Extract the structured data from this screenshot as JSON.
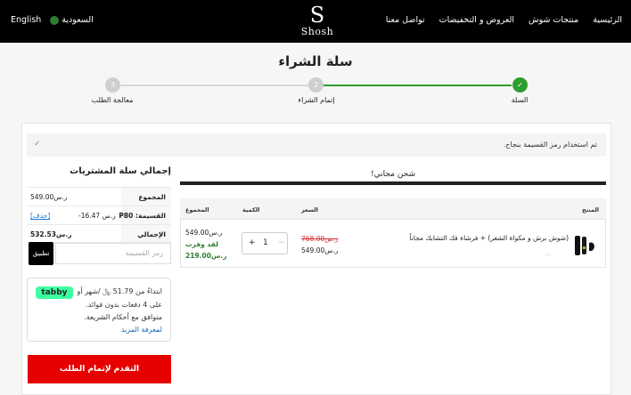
{
  "header": {
    "logo_glyph": "S",
    "logo_text": "Shosh",
    "nav": [
      "الرئيسية",
      "منتجات شوش",
      "العروض و التخفيضات",
      "تواصل معنا"
    ],
    "country": "السعودية",
    "language": "English"
  },
  "page_title": "سلة الشراء",
  "steps": [
    {
      "label": "السلة",
      "number": "✓",
      "state": "done"
    },
    {
      "label": "إتمام الشراء",
      "number": "2",
      "state": "pending"
    },
    {
      "label": "معالجة الطلب",
      "number": "3",
      "state": "pending"
    }
  ],
  "notice": {
    "text": "تم استخدام رمز القسيمة بنجاح.",
    "icon": "check-icon"
  },
  "summary": {
    "title": "إجمالي سلة المشتريات",
    "subtotal_label": "المجموع",
    "subtotal_value": "549.00ر.س",
    "coupon_label": "القسيمة: P80",
    "coupon_value": "-ر.س 16.47",
    "coupon_remove": "[حذف]",
    "total_label": "الإجمالي",
    "total_value": "532.53ر.س",
    "coupon_placeholder": "رمز القسيمة",
    "apply_label": "تطبيق"
  },
  "tabby": {
    "logo": "tabby",
    "line1": "ابتداءً من 51.79 ﷼ /شهر أو",
    "line2": "على 4 دفعات بدون فوائد.",
    "line3": "متوافق مع أحكام الشريعة.",
    "more": "لمعرفة المزيد"
  },
  "checkout_label": "التقدم لإتمام الطلب",
  "shipping": {
    "label": "شحن مجاني!",
    "progress": 1.0
  },
  "table": {
    "headers": {
      "product": "المنتج",
      "price": "السعر",
      "quantity": "الكمية",
      "total": "المجموع"
    },
    "item": {
      "name": "(شوش برش و مكواة الشعر) + فرشاة فك التشابك مجاناً",
      "meta": "—",
      "price_old": "768.00ر.س",
      "price_new": "549.00ر.س",
      "quantity": "1",
      "minus": "−",
      "plus": "+",
      "total": "549.00ر.س",
      "saved_label": "لقد وفرت",
      "saved_value": "219.00ر.س"
    }
  },
  "colors": {
    "accent": "#e60000",
    "success": "#2e7d32",
    "tabby": "#3bffa0",
    "step_done": "#2e9d2e"
  }
}
